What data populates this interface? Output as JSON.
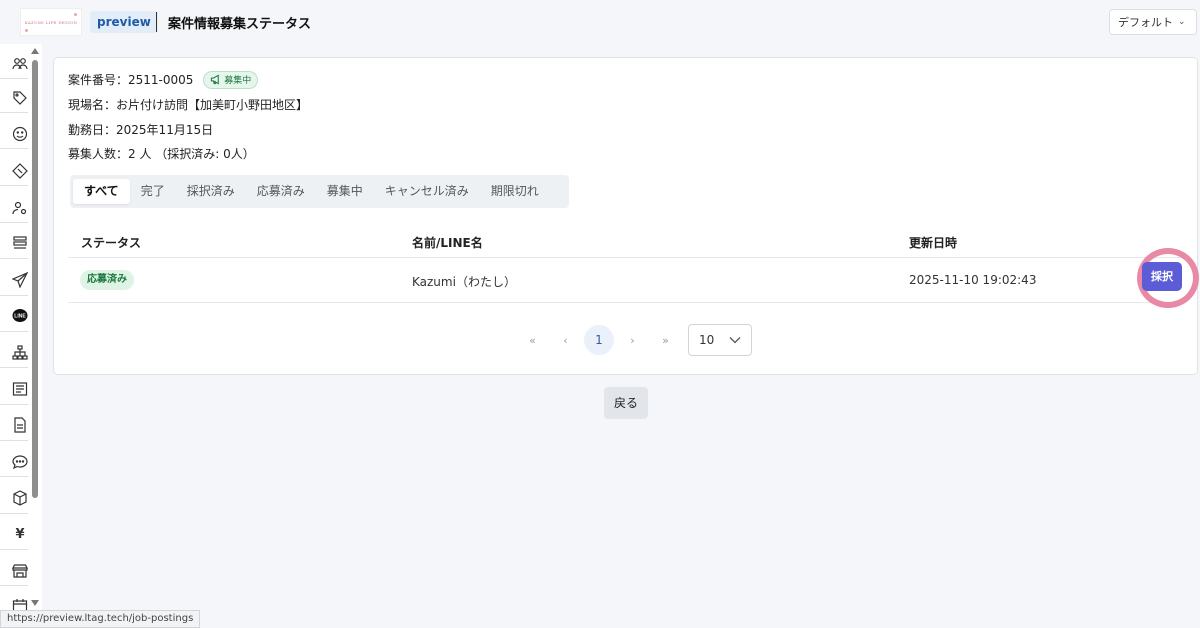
{
  "header": {
    "logo_text": "KAZUMI LIFE DESIGN",
    "env_badge": "preview",
    "title": "案件情報募集ステータス",
    "view_select": "デフォルト"
  },
  "sidebar": {
    "icons": [
      "users-icon",
      "tag-icon",
      "smile-icon",
      "ticket-icon",
      "user-settings-icon",
      "list-icon",
      "send-icon",
      "line-icon",
      "hierarchy-icon",
      "article-icon",
      "document-icon",
      "chat-icon",
      "box-icon",
      "yen-icon",
      "store-icon",
      "calendar-icon"
    ],
    "line_label": "LINE",
    "yen_symbol": "¥"
  },
  "job": {
    "number_label": "案件番号：",
    "number": "2511-0005",
    "status": "募集中",
    "site_label": "現場名：",
    "site": "お片付け訪問【加美町小野田地区】",
    "date_label": "勤務日：",
    "date": "2025年11月15日",
    "recruit_label": "募集人数：",
    "recruit": "2 人 （採択済み: 0人）"
  },
  "tabs": [
    "すべて",
    "完了",
    "採択済み",
    "応募済み",
    "募集中",
    "キャンセル済み",
    "期限切れ"
  ],
  "table": {
    "headers": [
      "ステータス",
      "名前/LINE名",
      "更新日時"
    ],
    "rows": [
      {
        "status": "応募済み",
        "name": "Kazumi（わたし）",
        "updated": "2025-11-10 19:02:43",
        "action": "採択"
      }
    ]
  },
  "pagination": {
    "first": "«",
    "prev": "‹",
    "current": "1",
    "next": "›",
    "last": "»",
    "page_size": "10"
  },
  "back_label": "戻る",
  "status_url": "https://preview.ltag.tech/job-postings",
  "colors": {
    "primary": "#5b5cd6",
    "highlight": "#e88aa5",
    "success": "#1b7a3e"
  }
}
